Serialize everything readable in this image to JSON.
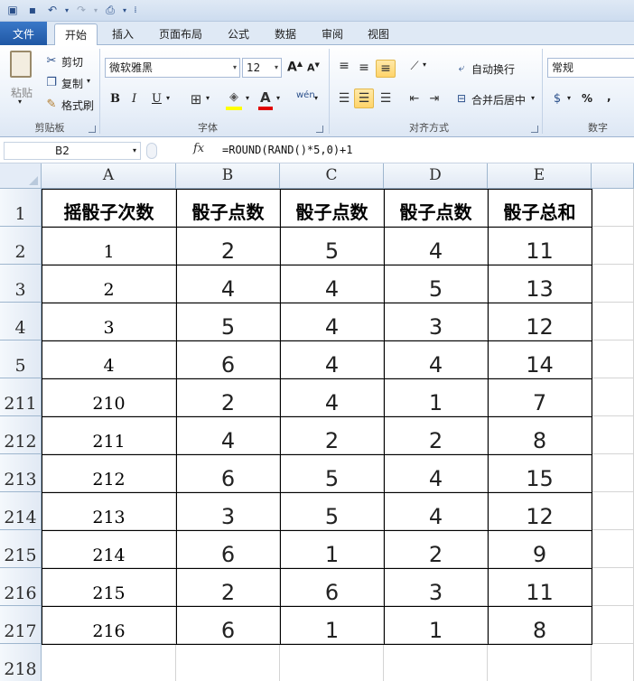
{
  "ribbon": {
    "tabs": [
      "文件",
      "开始",
      "插入",
      "页面布局",
      "公式",
      "数据",
      "审阅",
      "视图"
    ],
    "clipboard": {
      "paste": "粘贴",
      "cut": "剪切",
      "copy": "复制",
      "format_painter": "格式刷",
      "label": "剪贴板"
    },
    "font": {
      "name": "微软雅黑",
      "size": "12",
      "bold": "B",
      "italic": "I",
      "underline": "U",
      "label": "字体"
    },
    "alignment": {
      "wrap": "自动换行",
      "merge": "合并后居中",
      "label": "对齐方式"
    },
    "number": {
      "format": "常规",
      "percent": "%",
      "comma": ",",
      "label": "数字"
    }
  },
  "formula_bar": {
    "name_box": "B2",
    "fx": "fx",
    "formula": "=ROUND(RAND()*5,0)+1"
  },
  "grid": {
    "columns": [
      "A",
      "B",
      "C",
      "D",
      "E"
    ],
    "row_numbers": [
      "1",
      "2",
      "3",
      "4",
      "5",
      "211",
      "212",
      "213",
      "214",
      "215",
      "216",
      "217",
      "218"
    ],
    "header": [
      "摇骰子次数",
      "骰子点数",
      "骰子点数",
      "骰子点数",
      "骰子总和"
    ],
    "rows": [
      [
        "1",
        "2",
        "5",
        "4",
        "11"
      ],
      [
        "2",
        "4",
        "4",
        "5",
        "13"
      ],
      [
        "3",
        "5",
        "4",
        "3",
        "12"
      ],
      [
        "4",
        "6",
        "4",
        "4",
        "14"
      ],
      [
        "210",
        "2",
        "4",
        "1",
        "7"
      ],
      [
        "211",
        "4",
        "2",
        "2",
        "8"
      ],
      [
        "212",
        "6",
        "5",
        "4",
        "15"
      ],
      [
        "213",
        "3",
        "5",
        "4",
        "12"
      ],
      [
        "214",
        "6",
        "1",
        "2",
        "9"
      ],
      [
        "215",
        "2",
        "6",
        "3",
        "11"
      ],
      [
        "216",
        "6",
        "1",
        "1",
        "8"
      ]
    ]
  },
  "icons": [
    "save-icon",
    "undo-icon",
    "redo-icon",
    "print-preview-icon",
    "scissors-icon",
    "copy-icon",
    "brush-icon",
    "paint-bucket-icon",
    "font-color-icon",
    "borders-icon"
  ],
  "colors": {
    "file_tab": "#2b6ab8",
    "fill_highlight": "#ffff00",
    "font_color": "#e00000",
    "selected_align": "#ffd46a"
  }
}
